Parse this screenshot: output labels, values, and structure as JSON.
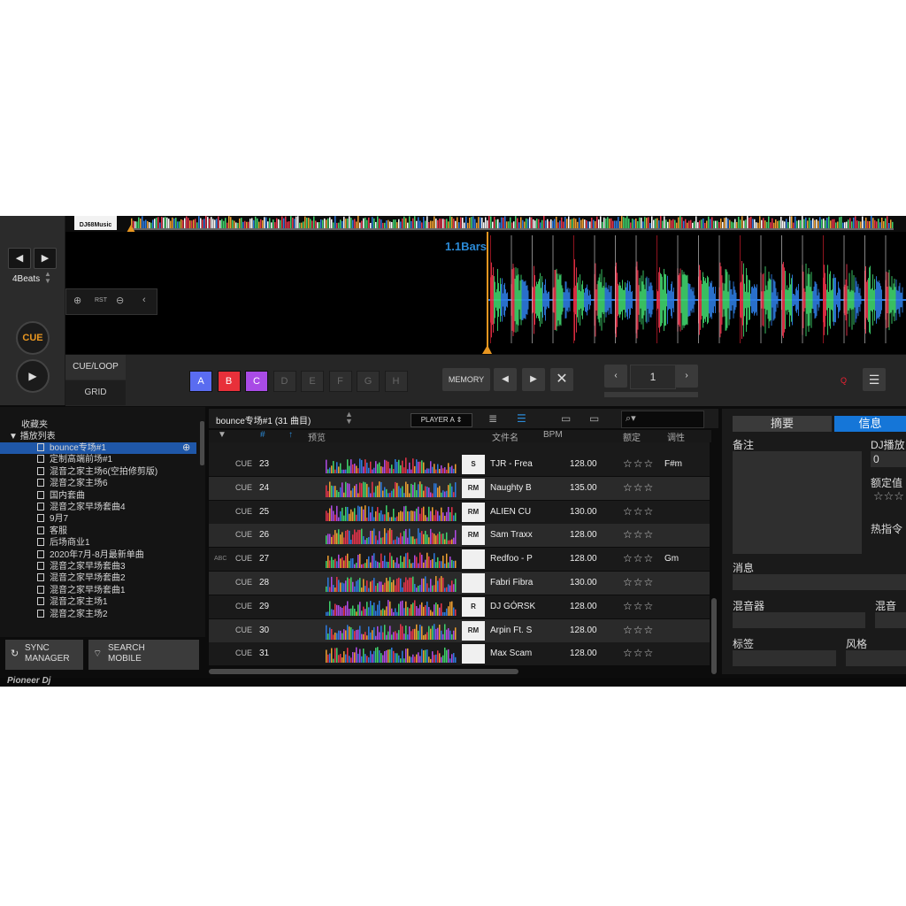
{
  "deck": {
    "logo_text": "DJ68Music",
    "beats_label": "4Beats",
    "zoom_reset": "RST",
    "bars_label": "1.1Bars",
    "cue_label": "CUE",
    "cue_loop_label": "CUE/LOOP",
    "grid_label": "GRID",
    "pads": [
      "A",
      "B",
      "C",
      "D",
      "E",
      "F",
      "G",
      "H"
    ],
    "pad_colors": [
      "#5a6cf0",
      "#e8303a",
      "#a94be6"
    ],
    "memory_label": "MEMORY",
    "loop_number": "1",
    "quantize_label": "Q"
  },
  "tree": {
    "favorites": "收藏夹",
    "playlists_header": "播放列表",
    "playlists": [
      "bounce专场#1",
      "定制高端前场#1",
      "混音之家主场6(空拍修剪版)",
      "混音之家主场6",
      "国内套曲",
      "混音之家早场套曲4",
      "9月7",
      "客服",
      "后场商业1",
      "2020年7月-8月最新单曲",
      "混音之家早场套曲3",
      "混音之家早场套曲2",
      "混音之家早场套曲1",
      "混音之家主场1",
      "混音之家主场2"
    ],
    "sync_manager": [
      "SYNC",
      "MANAGER"
    ],
    "search_mobile": [
      "SEARCH",
      "MOBILE"
    ]
  },
  "list": {
    "title": "bounce专场#1 (31 曲目)",
    "player_select": "PLAYER A",
    "columns": {
      "num": "#",
      "preview": "预览",
      "filename": "文件名",
      "bpm": "BPM",
      "rating": "额定",
      "key": "调性"
    },
    "rows": [
      {
        "cue": "CUE",
        "num": "23",
        "art": "S",
        "name": "TJR - Frea",
        "bpm": "128.00",
        "rating": "☆☆☆",
        "key": "F#m",
        "badge": ""
      },
      {
        "cue": "CUE",
        "num": "24",
        "art": "RM",
        "name": "Naughty B",
        "bpm": "135.00",
        "rating": "☆☆☆",
        "key": "",
        "badge": ""
      },
      {
        "cue": "CUE",
        "num": "25",
        "art": "RM",
        "name": "ALIEN CU",
        "bpm": "130.00",
        "rating": "☆☆☆",
        "key": "",
        "badge": ""
      },
      {
        "cue": "CUE",
        "num": "26",
        "art": "RM",
        "name": "Sam Traxx",
        "bpm": "128.00",
        "rating": "☆☆☆",
        "key": "",
        "badge": ""
      },
      {
        "cue": "CUE",
        "num": "27",
        "art": "",
        "name": "Redfoo - P",
        "bpm": "128.00",
        "rating": "☆☆☆",
        "key": "Gm",
        "badge": "ABC"
      },
      {
        "cue": "CUE",
        "num": "28",
        "art": "",
        "name": "Fabri Fibra",
        "bpm": "130.00",
        "rating": "☆☆☆",
        "key": "",
        "badge": ""
      },
      {
        "cue": "CUE",
        "num": "29",
        "art": "R",
        "name": "DJ GÓRSK",
        "bpm": "128.00",
        "rating": "☆☆☆",
        "key": "",
        "badge": ""
      },
      {
        "cue": "CUE",
        "num": "30",
        "art": "RM",
        "name": "Arpin Ft. S",
        "bpm": "128.00",
        "rating": "☆☆☆",
        "key": "",
        "badge": ""
      },
      {
        "cue": "CUE",
        "num": "31",
        "art": "",
        "name": "Max Scam",
        "bpm": "128.00",
        "rating": "☆☆☆",
        "key": "",
        "badge": ""
      }
    ]
  },
  "info": {
    "tab_summary": "摘要",
    "tab_info": "信息",
    "notes": "备注",
    "dj_play": "DJ播放",
    "dj_play_value": "0",
    "rating": "额定值",
    "rating_value": "☆☆☆",
    "hot_cue": "热指令",
    "message": "消息",
    "mixer": "混音器",
    "mix_name": "混音名",
    "tags": "标签",
    "style": "风格"
  },
  "footer": {
    "brand": "Pioneer Dj"
  }
}
